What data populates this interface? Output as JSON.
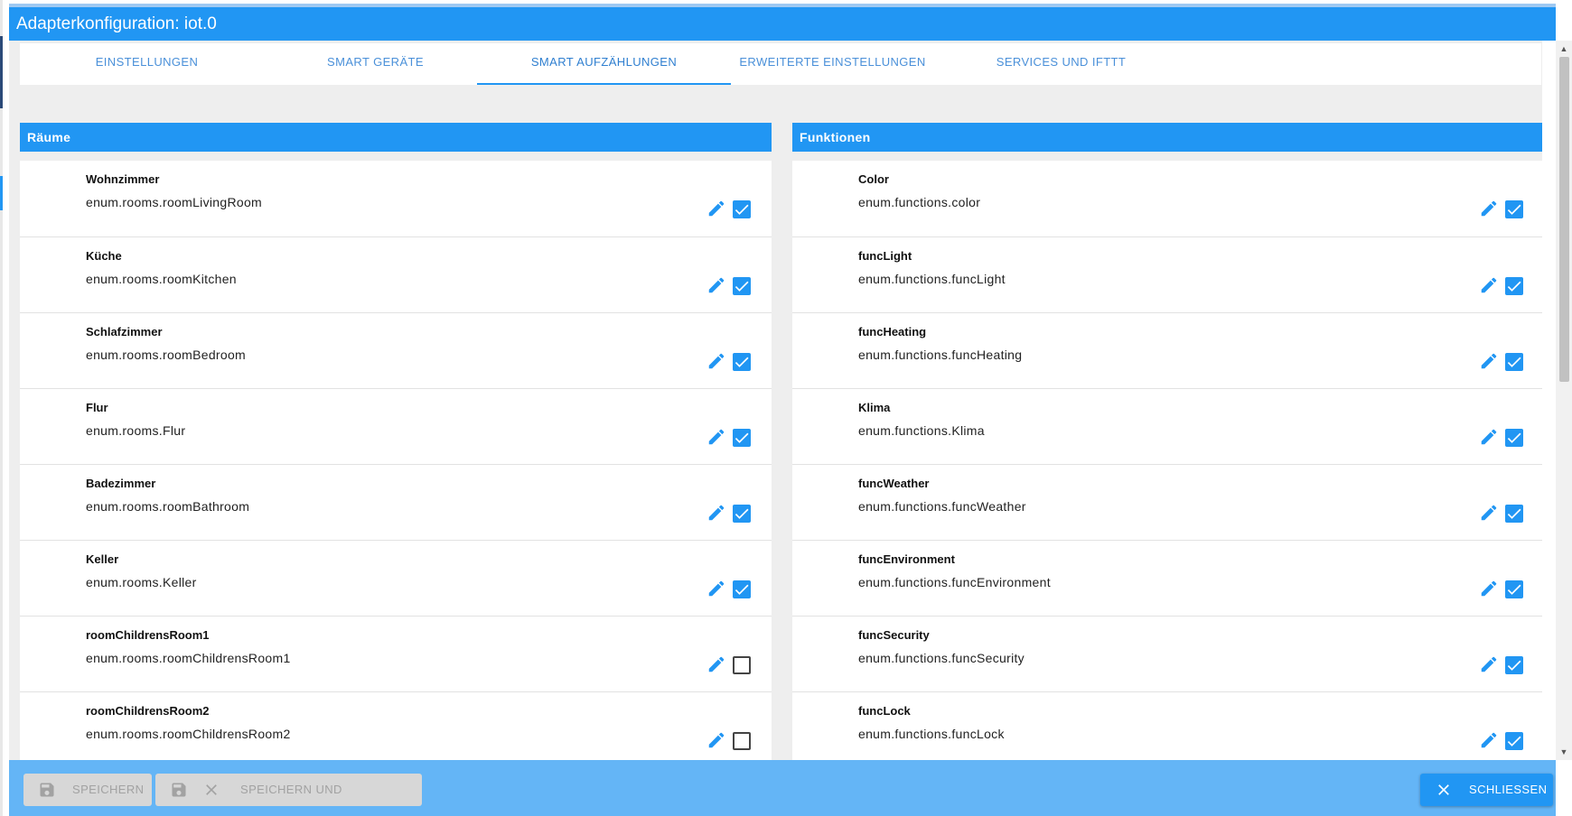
{
  "window": {
    "title": "Adapterkonfiguration: iot.0"
  },
  "tabs": [
    {
      "label": "EINSTELLUNGEN"
    },
    {
      "label": "SMART GERÄTE"
    },
    {
      "label": "SMART AUFZÄHLUNGEN",
      "active": true
    },
    {
      "label": "ERWEITERTE EINSTELLUNGEN"
    },
    {
      "label": "SERVICES UND IFTTT"
    }
  ],
  "rooms": {
    "title": "Räume",
    "items": [
      {
        "name": "Wohnzimmer",
        "id": "enum.rooms.roomLivingRoom",
        "checked": true
      },
      {
        "name": "Küche",
        "id": "enum.rooms.roomKitchen",
        "checked": true
      },
      {
        "name": "Schlafzimmer",
        "id": "enum.rooms.roomBedroom",
        "checked": true
      },
      {
        "name": "Flur",
        "id": "enum.rooms.Flur",
        "checked": true
      },
      {
        "name": "Badezimmer",
        "id": "enum.rooms.roomBathroom",
        "checked": true
      },
      {
        "name": "Keller",
        "id": "enum.rooms.Keller",
        "checked": true
      },
      {
        "name": "roomChildrensRoom1",
        "id": "enum.rooms.roomChildrensRoom1",
        "checked": false
      },
      {
        "name": "roomChildrensRoom2",
        "id": "enum.rooms.roomChildrensRoom2",
        "checked": false
      }
    ]
  },
  "functions": {
    "title": "Funktionen",
    "items": [
      {
        "name": "Color",
        "id": "enum.functions.color",
        "checked": true
      },
      {
        "name": "funcLight",
        "id": "enum.functions.funcLight",
        "checked": true
      },
      {
        "name": "funcHeating",
        "id": "enum.functions.funcHeating",
        "checked": true
      },
      {
        "name": "Klima",
        "id": "enum.functions.Klima",
        "checked": true
      },
      {
        "name": "funcWeather",
        "id": "enum.functions.funcWeather",
        "checked": true
      },
      {
        "name": "funcEnvironment",
        "id": "enum.functions.funcEnvironment",
        "checked": true
      },
      {
        "name": "funcSecurity",
        "id": "enum.functions.funcSecurity",
        "checked": true
      },
      {
        "name": "funcLock",
        "id": "enum.functions.funcLock",
        "checked": true
      }
    ]
  },
  "footer": {
    "save_label": "SPEICHERN",
    "save_close_label": "SPEICHERN UND SCHLIESSEN",
    "close_label": "SCHLIESSEN"
  },
  "icons": {
    "edit": "pencil-icon",
    "checkbox": "checkbox-icon",
    "save": "save-icon",
    "close": "close-icon"
  },
  "colors": {
    "accent": "#2196f3",
    "footer": "#64b5f6",
    "disabled_button": "#d7d7d7"
  }
}
